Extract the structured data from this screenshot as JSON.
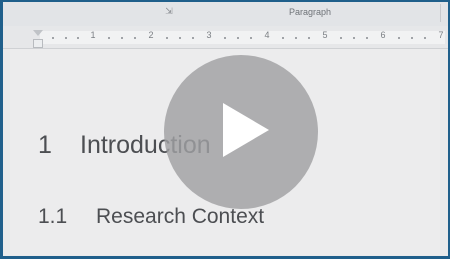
{
  "ribbon": {
    "launcher_icon": "dialog-launcher-icon",
    "group_label": "Paragraph"
  },
  "ruler": {
    "numbers": [
      "1",
      "2",
      "3",
      "4",
      "5",
      "6",
      "7"
    ]
  },
  "document": {
    "heading1": {
      "number": "1",
      "text": "Introduction"
    },
    "heading2": {
      "number": "1.1",
      "text": "Research Context"
    }
  },
  "video_overlay": {
    "play_icon": "play-icon",
    "overlay_color": "#a0a0a2"
  },
  "colors": {
    "frame_border": "#1f5f8b",
    "heading_text": "#4c4e52"
  }
}
